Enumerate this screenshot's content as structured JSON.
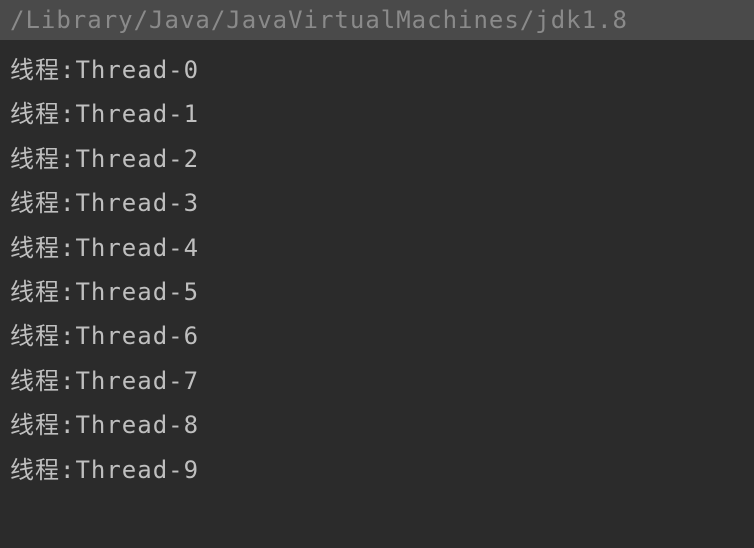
{
  "header": {
    "path": "/Library/Java/JavaVirtualMachines/jdk1.8"
  },
  "output": {
    "lines": [
      "线程:Thread-0",
      "线程:Thread-1",
      "线程:Thread-2",
      "线程:Thread-3",
      "线程:Thread-4",
      "线程:Thread-5",
      "线程:Thread-6",
      "线程:Thread-7",
      "线程:Thread-8",
      "线程:Thread-9"
    ]
  }
}
